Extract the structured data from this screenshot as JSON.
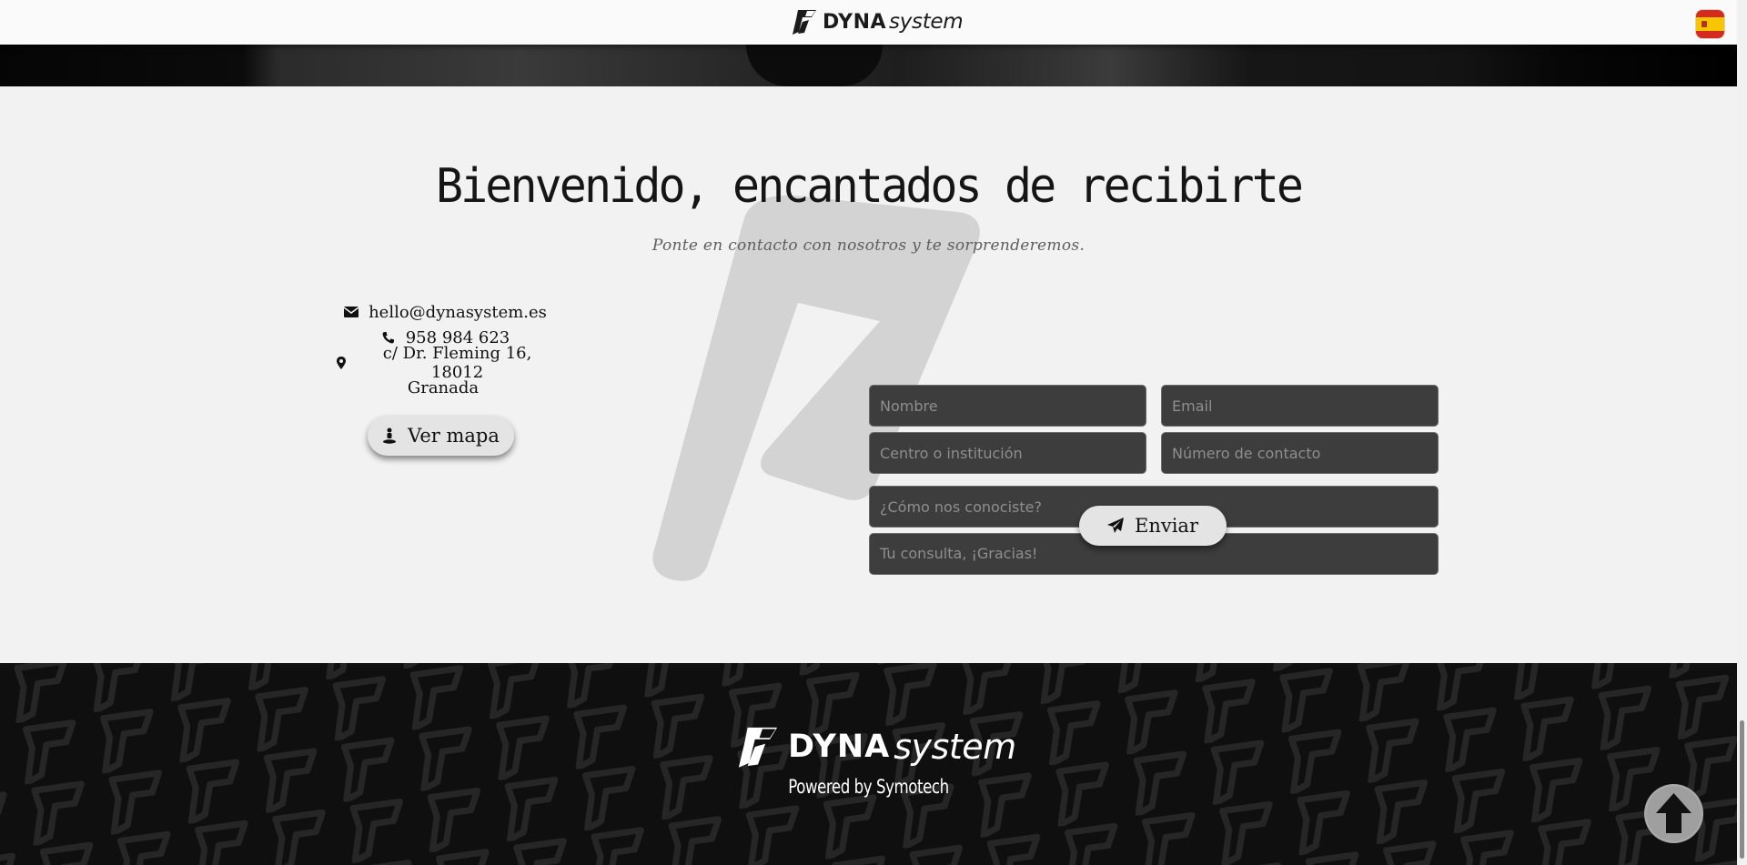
{
  "navbar": {
    "brand_bold": "DYNA",
    "brand_light": "system",
    "language_flag": "spain-flag-icon"
  },
  "contact": {
    "title": "Bienvenido, encantados de recibirte",
    "subtitle": "Ponte en contacto con nosotros y te sorprenderemos.",
    "email": "hello@dynasystem.es",
    "phone": "958 984 623",
    "address_line1": "c/ Dr. Fleming 16, 18012",
    "address_line2": "Granada",
    "map_button_label": "Ver mapa",
    "form": {
      "nombre_placeholder": "Nombre",
      "email_placeholder": "Email",
      "centro_placeholder": "Centro o institución",
      "numero_placeholder": "Número de contacto",
      "como_placeholder": "¿Cómo nos conociste?",
      "consulta_placeholder": "Tu consulta, ¡Gracias!",
      "send_label": "Enviar"
    }
  },
  "footer": {
    "brand_bold": "DYNA",
    "brand_light": "system",
    "powered_by": "Powered by Symotech"
  },
  "colors": {
    "field_bg": "#3d3d3d",
    "section_bg": "#f2f2f2",
    "footer_bg": "#0f0f0f",
    "button_bg": "#e4e4e4"
  }
}
